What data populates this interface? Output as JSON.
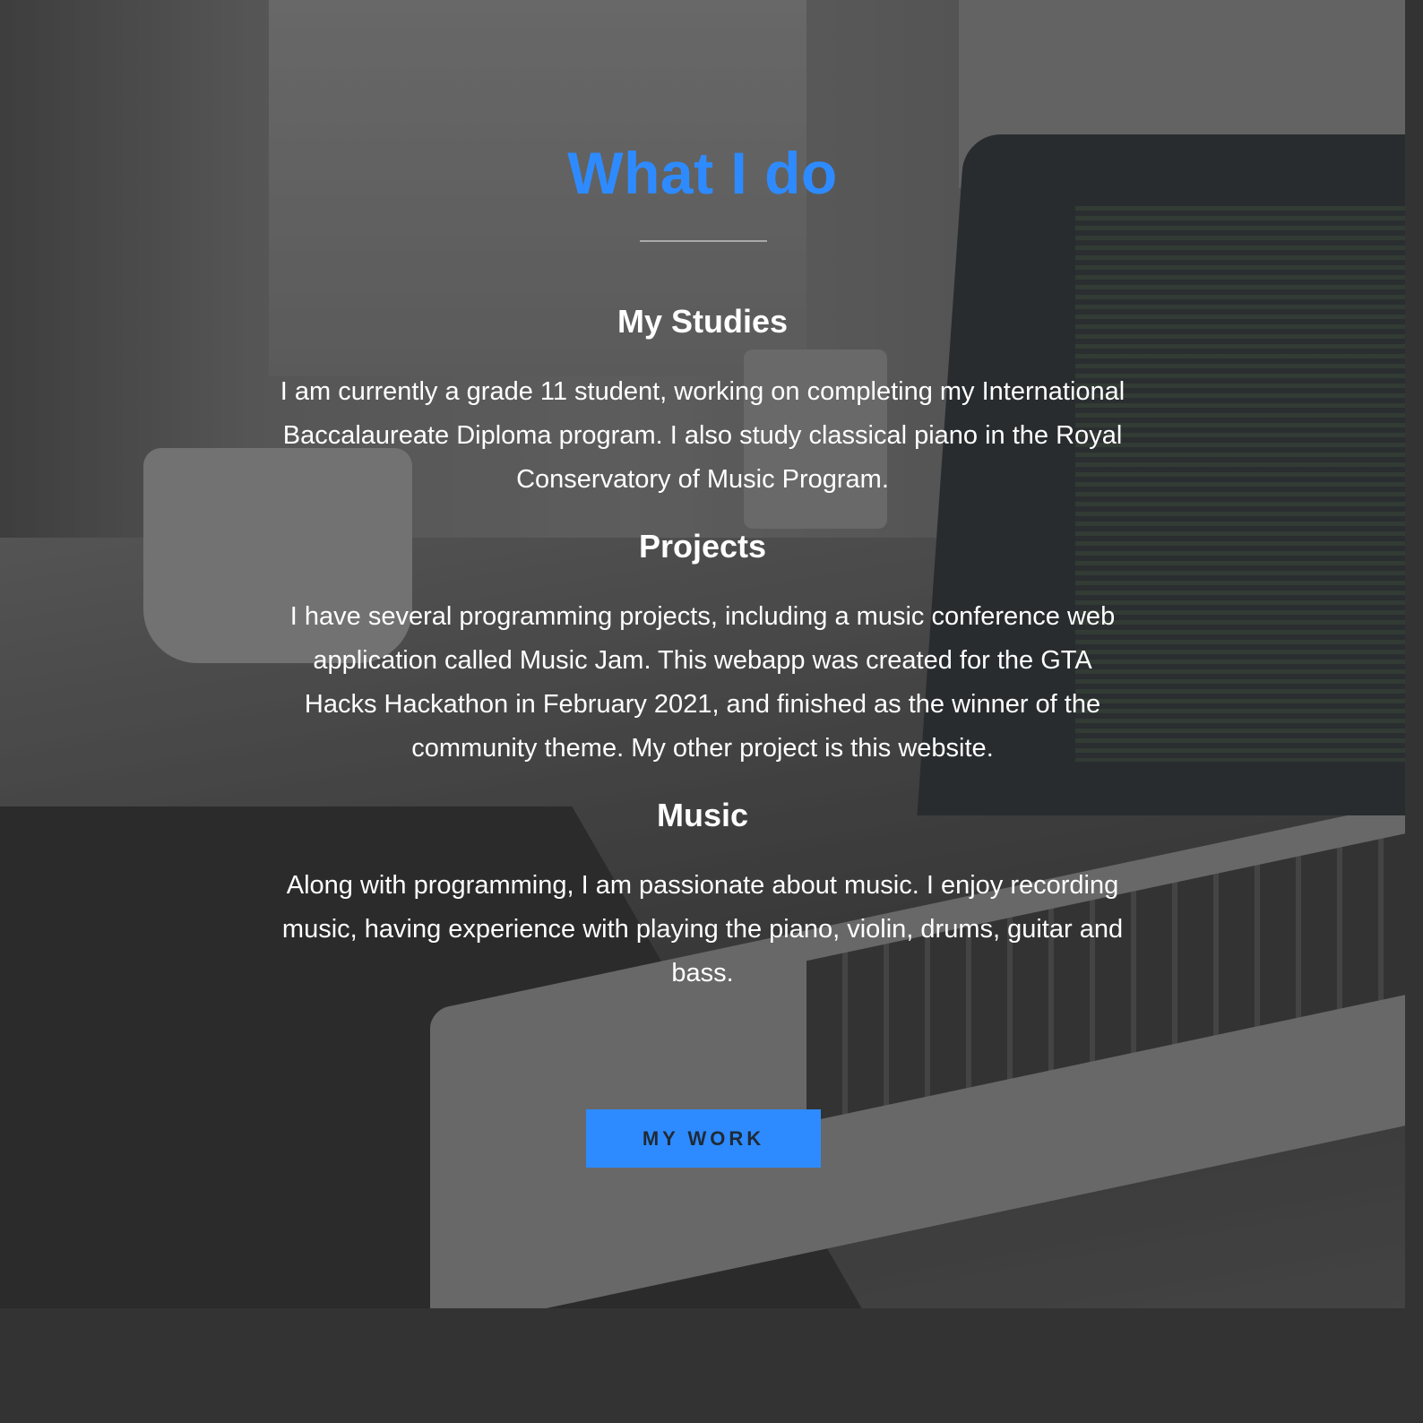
{
  "section": {
    "title": "What I do",
    "colors": {
      "accent": "#2e8bff",
      "heading": "#ffffff",
      "footer": "#333333"
    }
  },
  "blocks": [
    {
      "heading": "My Studies",
      "text": "I am currently a grade 11 student, working on completing my International Baccalaureate Diploma program. I also study classical piano in the Royal Conservatory of Music Program."
    },
    {
      "heading": "Projects",
      "text": "I have several programming projects, including a music conference web application called Music Jam. This webapp was created for the GTA Hacks Hackathon in February 2021, and finished as the winner of the community theme. My other project is this website."
    },
    {
      "heading": "Music",
      "text": "Along with programming, I am passionate about music. I enjoy recording music, having experience with playing the piano, violin, drums, guitar and bass."
    }
  ],
  "cta": {
    "label": "MY WORK"
  }
}
